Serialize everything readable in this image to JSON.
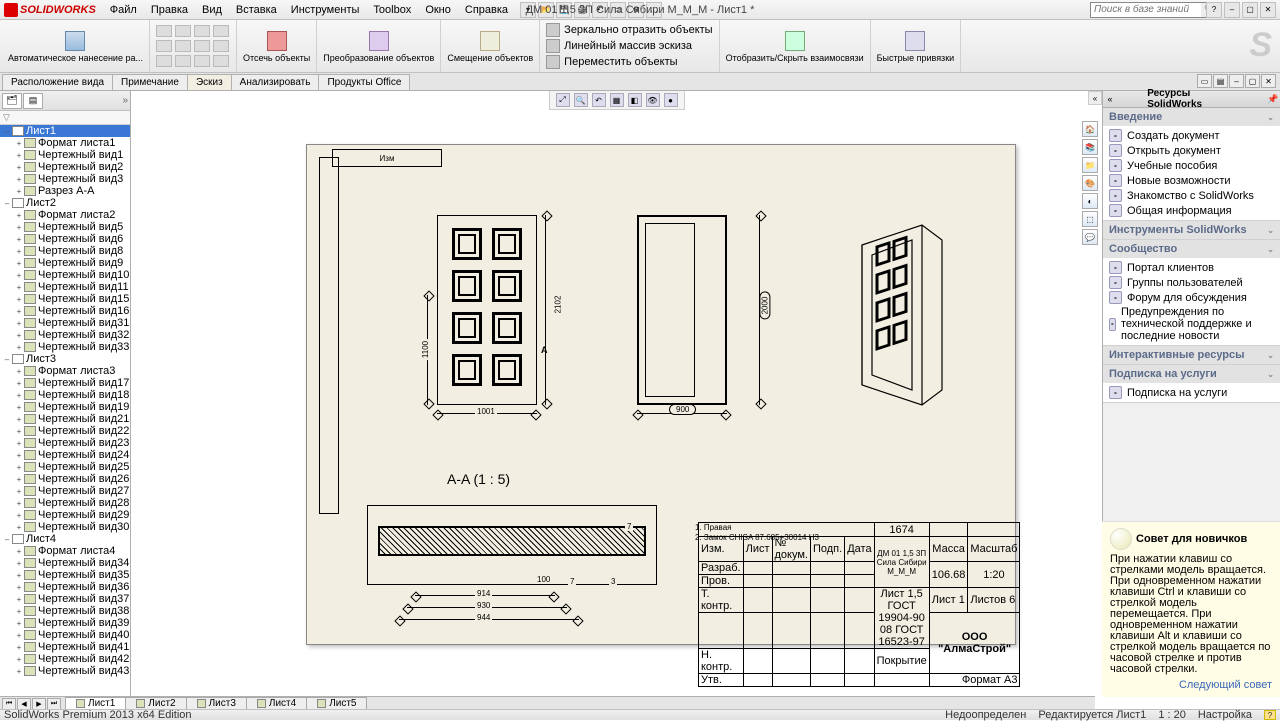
{
  "app": {
    "brand": "SOLIDWORKS",
    "title": "ДМ 01 1,5 3П Сила Сибири М_М_М - Лист1 *"
  },
  "menu": [
    "Файл",
    "Правка",
    "Вид",
    "Вставка",
    "Инструменты",
    "Toolbox",
    "Окно",
    "Справка"
  ],
  "search": {
    "placeholder": "Поиск в базе знаний"
  },
  "ribbon": {
    "group1": "Автоматическое\nнанесение ра...",
    "cut": "Отсечь\nобъекты",
    "transform": "Преобразование\nобъектов",
    "offset": "Смещение\nобъектов",
    "mirror": "Зеркально отразить объекты",
    "linear": "Линейный массив эскиза",
    "move": "Переместить объекты",
    "showrel": "Отобразить/Скрыть\nвзаимосвязи",
    "quicksnap": "Быстрые\nпривязки"
  },
  "cmdtabs": [
    "Расположение вида",
    "Примечание",
    "Эскиз",
    "Анализировать",
    "Продукты Office"
  ],
  "cmdtab_active": 2,
  "tree": {
    "sheets": [
      {
        "name": "Лист1",
        "open": true,
        "sel": true,
        "items": [
          "Формат листа1",
          "Чертежный вид1",
          "Чертежный вид2",
          "Чертежный вид3",
          "Разрез A-A"
        ]
      },
      {
        "name": "Лист2",
        "open": true,
        "items": [
          "Формат листа2",
          "Чертежный вид5",
          "Чертежный вид6",
          "Чертежный вид8",
          "Чертежный вид9",
          "Чертежный вид10",
          "Чертежный вид11",
          "Чертежный вид15",
          "Чертежный вид16",
          "Чертежный вид31",
          "Чертежный вид32",
          "Чертежный вид33"
        ]
      },
      {
        "name": "Лист3",
        "open": true,
        "items": [
          "Формат листа3",
          "Чертежный вид17",
          "Чертежный вид18",
          "Чертежный вид19",
          "Чертежный вид21",
          "Чертежный вид22",
          "Чертежный вид23",
          "Чертежный вид24",
          "Чертежный вид25",
          "Чертежный вид26",
          "Чертежный вид27",
          "Чертежный вид28",
          "Чертежный вид29",
          "Чертежный вид30"
        ]
      },
      {
        "name": "Лист4",
        "open": true,
        "items": [
          "Формат листа4",
          "Чертежный вид34",
          "Чертежный вид35",
          "Чертежный вид36",
          "Чертежный вид37",
          "Чертежный вид38",
          "Чертежный вид39",
          "Чертежный вид40",
          "Чертежный вид41",
          "Чертежный вид42",
          "Чертежный вид43"
        ]
      }
    ]
  },
  "drawing": {
    "sec_label": "A-A  (1 : 5)",
    "dims": {
      "w_front": "1001",
      "h_front": "2102",
      "h_left": "1100",
      "w_open": "900",
      "h_open": "2000",
      "sec_a": "914",
      "sec_b": "930",
      "sec_c": "944",
      "sec_d": "100",
      "sec_t": "7",
      "sec_t2": "3"
    },
    "notes": [
      "1.   Правая",
      "2.   Замок CHISA 87.685+30014 H3"
    ],
    "tb": {
      "weight_cell": "1674",
      "mass": "106.68",
      "scale": "1:20",
      "title": "ДМ 01 1,5 3П Сила Сибири М_М_М",
      "org": "ООО \"АлмаСтрой\"",
      "gostA": "Лист 1,5 ГОСТ 19904-90",
      "gostB": "08 ГОСТ 16523-97",
      "sheet": "Лист 1",
      "sheets": "Листов 6",
      "fmt": "Формат A3",
      "rows": [
        "Разраб.",
        "Пров.",
        "Т. контр.",
        "",
        "Н. контр.",
        "Утв."
      ],
      "hdrs": [
        "Изм.",
        "Лист",
        "№ докум.",
        "Подп.",
        "Дата"
      ],
      "side": [
        "Масса",
        "Масштаб"
      ],
      "cover": "Покрытие"
    },
    "rev": "Изм"
  },
  "sheets_bottom": [
    "Лист1",
    "Лист2",
    "Лист3",
    "Лист4",
    "Лист5"
  ],
  "sheet_active": 0,
  "right": {
    "title": "Ресурсы SolidWorks",
    "sections": [
      {
        "h": "Введение",
        "items": [
          "Создать документ",
          "Открыть документ",
          "Учебные пособия",
          "Новые возможности",
          "Знакомство с SolidWorks",
          "Общая информация"
        ]
      },
      {
        "h": "Инструменты SolidWorks",
        "items": []
      },
      {
        "h": "Сообщество",
        "items": [
          "Портал клиентов",
          "Группы пользователей",
          "Форум для обсуждения",
          "Предупреждения по технической поддержке и последние новости"
        ]
      },
      {
        "h": "Интерактивные ресурсы",
        "items": []
      },
      {
        "h": "Подписка на услуги",
        "items": [
          "Подписка на услуги"
        ]
      }
    ],
    "tip_h": "Совет для новичков",
    "tip": "При нажатии клавиш со стрелками модель вращается. При одновременном нажатии клавиши Ctrl и клавиши со стрелкой модель перемещается. При одновременном нажатии клавиши Alt и клавиши со стрелкой модель вращается по часовой стрелке и против часовой стрелки.",
    "tip_next": "Следующий совет"
  },
  "status": {
    "left": "SolidWorks Premium 2013 x64 Edition",
    "undef": "Недоопределен",
    "edit": "Редактируется Лист1",
    "scale": "1 : 20",
    "custom": "Настройка"
  }
}
